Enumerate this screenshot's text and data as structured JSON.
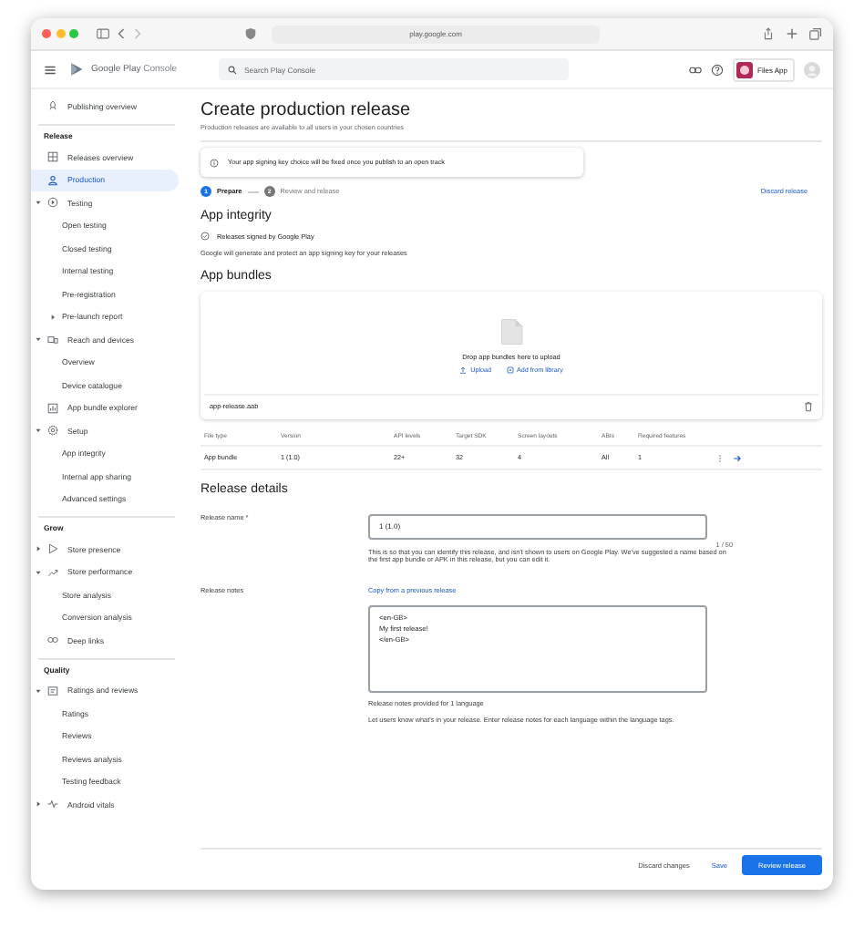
{
  "browser": {
    "address": "play.google.com"
  },
  "header": {
    "product": "Google Play",
    "product_suffix": "Console",
    "search": {
      "placeholder": "Search Play Console"
    },
    "app_name": "Files App"
  },
  "sidebar": {
    "top_item": {
      "label": "Publishing overview",
      "selected": false
    },
    "sections": [
      {
        "title": "Release",
        "items": [
          {
            "label": "Releases overview",
            "selected": false
          },
          {
            "label": "Production",
            "selected": true
          },
          {
            "label": "Testing",
            "selected": false,
            "expanded": true,
            "children": [
              {
                "label": "Open testing",
                "selected": false
              },
              {
                "label": "Closed testing",
                "selected": false
              },
              {
                "label": "Internal testing",
                "selected": false
              },
              {
                "label": "Pre-registration",
                "selected": false
              },
              {
                "label": "Pre-launch report",
                "selected": false,
                "expanded": false
              }
            ]
          },
          {
            "label": "Reach and devices",
            "selected": false,
            "expanded": true,
            "children": [
              {
                "label": "Overview",
                "selected": false
              },
              {
                "label": "Device catalogue",
                "selected": false
              }
            ]
          },
          {
            "label": "App bundle explorer",
            "selected": false
          },
          {
            "label": "Setup",
            "selected": false,
            "expanded": true,
            "children": [
              {
                "label": "App integrity",
                "selected": false
              },
              {
                "label": "Internal app sharing",
                "selected": false
              },
              {
                "label": "Advanced settings",
                "selected": false
              }
            ]
          }
        ]
      },
      {
        "title": "Grow",
        "items": [
          {
            "label": "Store presence",
            "selected": false,
            "expanded": false
          },
          {
            "label": "Store performance",
            "selected": false,
            "expanded": true,
            "children": [
              {
                "label": "Store analysis",
                "selected": false
              },
              {
                "label": "Conversion analysis",
                "selected": false
              }
            ]
          },
          {
            "label": "Deep links",
            "selected": false
          }
        ]
      },
      {
        "title": "Quality",
        "items": [
          {
            "label": "Ratings and reviews",
            "selected": false,
            "expanded": true,
            "children": [
              {
                "label": "Ratings",
                "selected": false
              },
              {
                "label": "Reviews",
                "selected": false
              },
              {
                "label": "Reviews analysis",
                "selected": false
              },
              {
                "label": "Testing feedback",
                "selected": false
              }
            ]
          },
          {
            "label": "Android vitals",
            "selected": false,
            "expanded": false
          }
        ]
      }
    ]
  },
  "page": {
    "title": "Create production release",
    "subtitle": "Production releases are available to all users in your chosen countries",
    "notice": "Your app signing key choice will be fixed once you publish to an open track",
    "steps": [
      {
        "number": "1",
        "label": "Prepare",
        "selected": true
      },
      {
        "number": "2",
        "label": "Review and release",
        "selected": false
      }
    ],
    "discard_link": "Discard release",
    "integrity": {
      "heading": "App integrity",
      "status": "Releases signed by Google Play",
      "description": "Google will generate and protect an app signing key for your releases"
    },
    "bundles": {
      "heading": "App bundles",
      "drop_text": "Drop app bundles here to upload",
      "actions": [
        "Upload",
        "Add from library"
      ],
      "file_name": "app-release.aab",
      "table": {
        "columns": [
          "File type",
          "Version",
          "API levels",
          "Target SDK",
          "Screen layouts",
          "ABIs",
          "Required features"
        ],
        "rows": [
          [
            "App bundle",
            "1 (1.0)",
            "22+",
            "32",
            "4",
            "All",
            "1"
          ]
        ]
      }
    },
    "details": {
      "heading": "Release details",
      "name_field": {
        "label": "Release name *",
        "value": "1 (1.0)",
        "counter": "1 / 50",
        "help": "This is so that you can identify this release, and isn't shown to users on Google Play. We've suggested a name based on the first app bundle or APK in this release, but you can edit it."
      },
      "notes": {
        "label": "Release notes",
        "copy_link": "Copy from a previous release",
        "value": "<en-GB>\nMy first release!\n</en-GB>",
        "provided": "Release notes provided for 1 language",
        "help": "Let users know what's in your release. Enter release notes for each language within the language tags."
      }
    }
  },
  "footer": {
    "buttons": [
      {
        "label": "Discard changes",
        "kind": "text"
      },
      {
        "label": "Save",
        "kind": "link"
      },
      {
        "label": "Review release",
        "kind": "primary"
      }
    ]
  }
}
